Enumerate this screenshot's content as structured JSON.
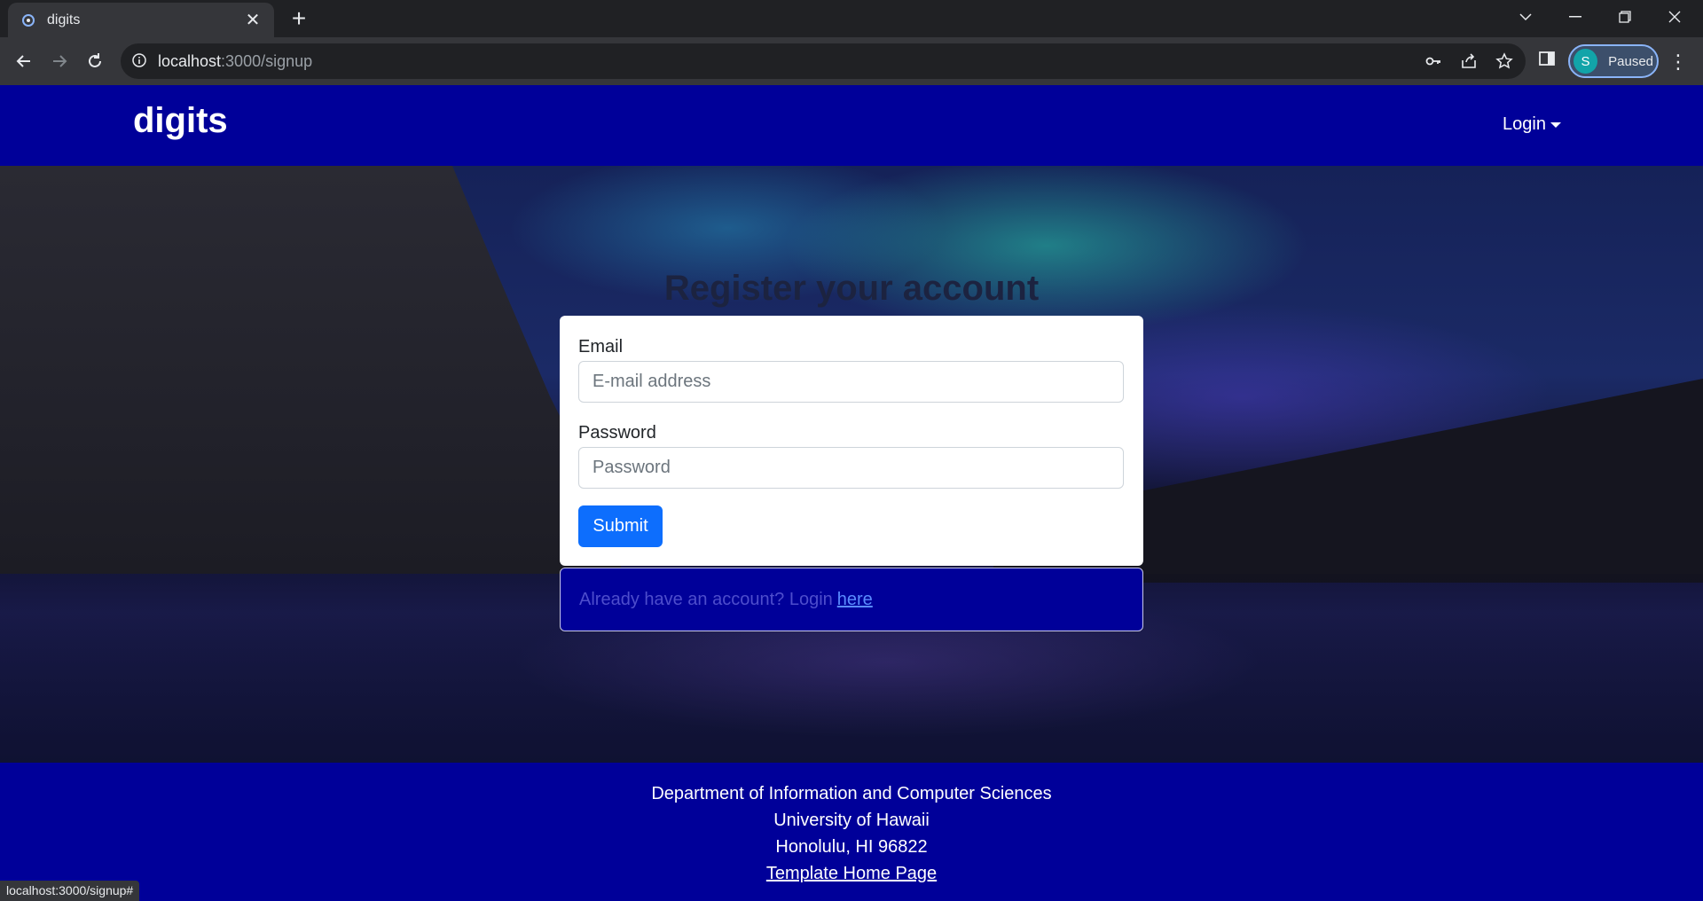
{
  "browser": {
    "tab_title": "digits",
    "url_host": "localhost",
    "url_path": ":3000/signup",
    "profile_initial": "S",
    "profile_status": "Paused",
    "status_bar": "localhost:3000/signup#"
  },
  "navbar": {
    "brand": "digits",
    "login_label": "Login"
  },
  "form": {
    "title": "Register your account",
    "email_label": "Email",
    "email_placeholder": "E-mail address",
    "password_label": "Password",
    "password_placeholder": "Password",
    "submit_label": "Submit"
  },
  "login_prompt": {
    "text": "Already have an account? Login",
    "link": "here"
  },
  "footer": {
    "line1": "Department of Information and Computer Sciences",
    "line2": "University of Hawaii",
    "line3": "Honolulu, HI 96822",
    "link": "Template Home Page"
  },
  "colors": {
    "navbar": "#000099",
    "submit": "#0d6efd"
  }
}
